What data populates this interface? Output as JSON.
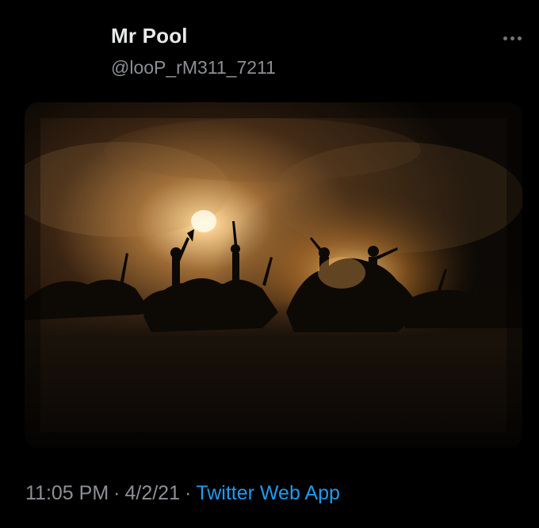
{
  "author": {
    "name": "Mr Pool",
    "handle": "@looP_rM311_7211"
  },
  "menu": {
    "icon": "more-horizontal-icon"
  },
  "media": {
    "icon": "photo-battle-silhouettes"
  },
  "meta": {
    "time": "11:05 PM",
    "separator": "·",
    "date": "4/2/21",
    "source": "Twitter Web App"
  },
  "colors": {
    "background": "#000000",
    "name": "#e7e9ea",
    "secondary": "#8b9096",
    "link": "#1d9bf0"
  }
}
